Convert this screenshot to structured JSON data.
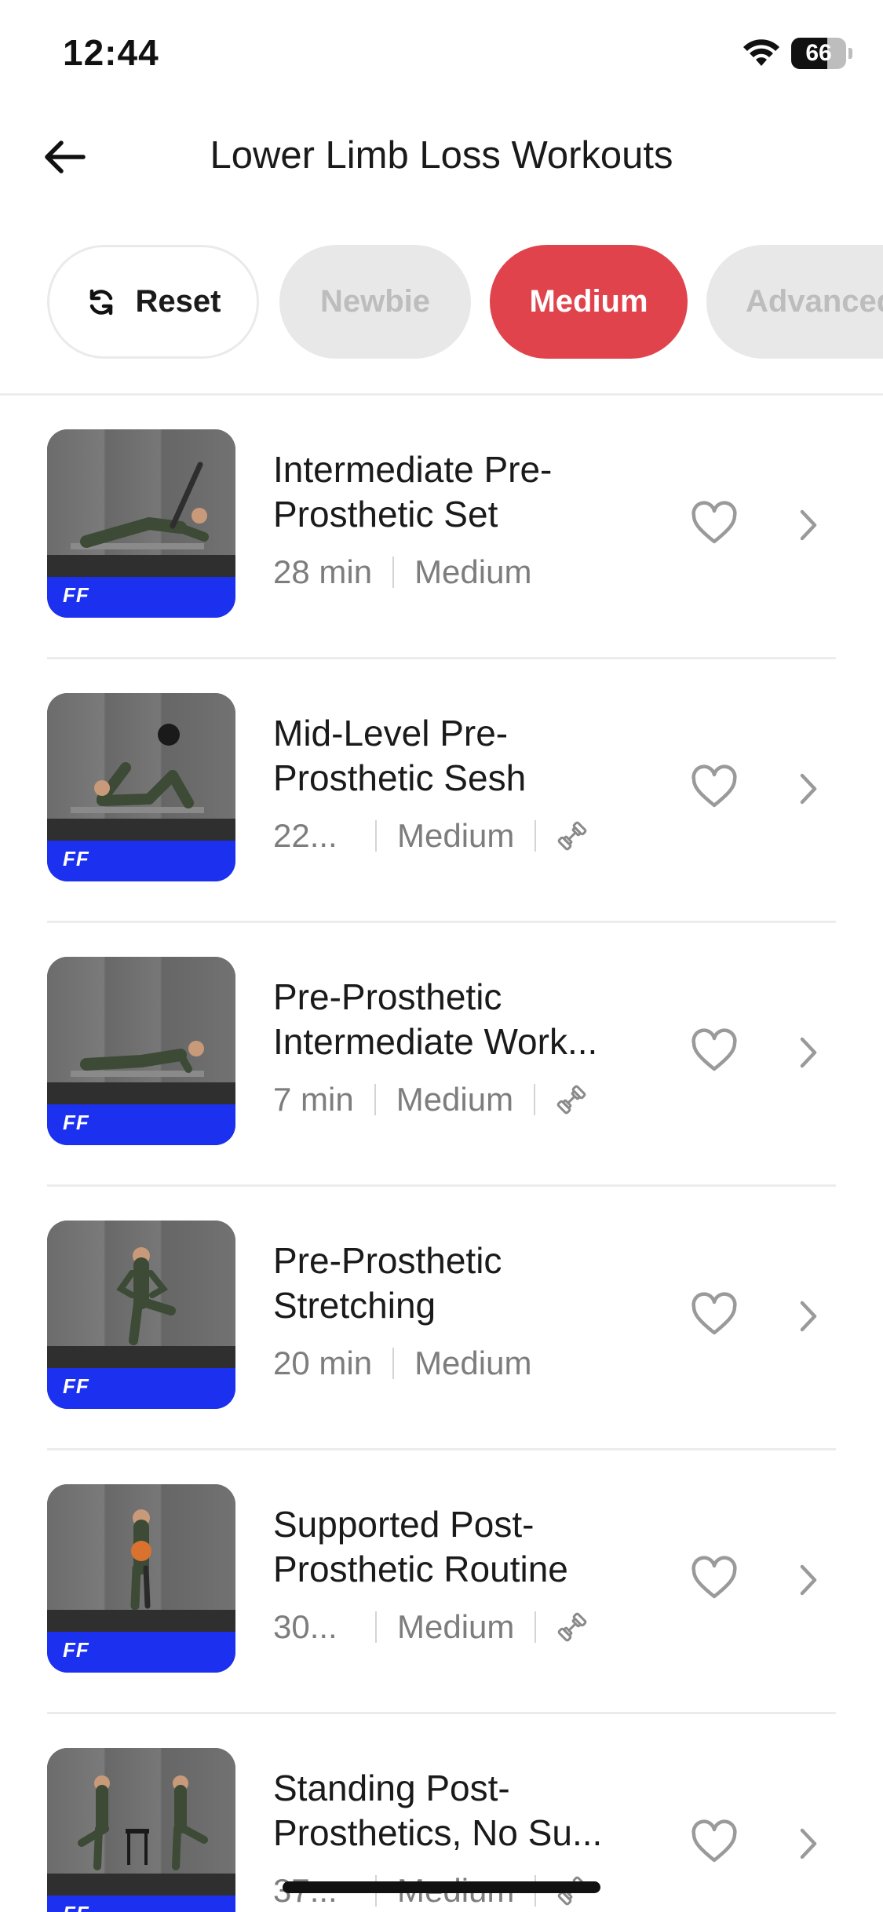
{
  "status_bar": {
    "time": "12:44",
    "battery": "66",
    "wifi_icon": "wifi-icon"
  },
  "header": {
    "title": "Lower Limb Loss Workouts",
    "back_icon": "arrow-left-icon"
  },
  "filters": {
    "reset_label": "Reset",
    "newbie_label": "Newbie",
    "medium_label": "Medium",
    "advanced_label": "Advanced",
    "active_color": "#e0434b",
    "inactive_color": "#e8e8e8"
  },
  "workouts": [
    {
      "title": "Intermediate Pre-Prosthetic Set",
      "duration": "28 min",
      "level": "Medium",
      "equipment": false
    },
    {
      "title": "Mid-Level Pre-Prosthetic Sesh",
      "duration": "22...",
      "level": "Medium",
      "equipment": true
    },
    {
      "title": "Pre-Prosthetic Intermediate Work...",
      "duration": "7 min",
      "level": "Medium",
      "equipment": true
    },
    {
      "title": "Pre-Prosthetic Stretching",
      "duration": "20 min",
      "level": "Medium",
      "equipment": false
    },
    {
      "title": "Supported Post-Prosthetic Routine",
      "duration": "30...",
      "level": "Medium",
      "equipment": true
    },
    {
      "title": "Standing Post-Prosthetics, No Su...",
      "duration": "37...",
      "level": "Medium",
      "equipment": true
    }
  ],
  "thumbnail_logo": "FF",
  "colors": {
    "accent": "#e0434b",
    "brand_band": "#1c30f0"
  }
}
